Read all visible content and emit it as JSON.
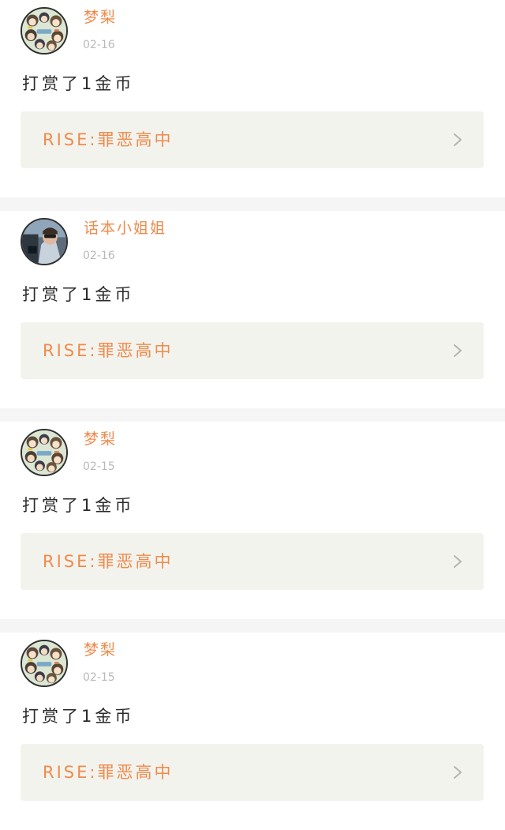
{
  "feed": {
    "items": [
      {
        "username": "梦梨",
        "date": "02-16",
        "action": "打赏了1金币",
        "link_title": "RISE:罪恶高中",
        "avatar": "avatar-anime-group"
      },
      {
        "username": "话本小姐姐",
        "date": "02-16",
        "action": "打赏了1金币",
        "link_title": "RISE:罪恶高中",
        "avatar": "avatar-person-photo"
      },
      {
        "username": "梦梨",
        "date": "02-15",
        "action": "打赏了1金币",
        "link_title": "RISE:罪恶高中",
        "avatar": "avatar-anime-group"
      },
      {
        "username": "梦梨",
        "date": "02-15",
        "action": "打赏了1金币",
        "link_title": "RISE:罪恶高中",
        "avatar": "avatar-anime-group"
      }
    ]
  },
  "colors": {
    "username": "#f08a4b",
    "date": "#b9b9b9",
    "action_text": "#2a2a2a",
    "link_box_bg": "#f3f3ee",
    "separator": "#f5f5f5"
  }
}
